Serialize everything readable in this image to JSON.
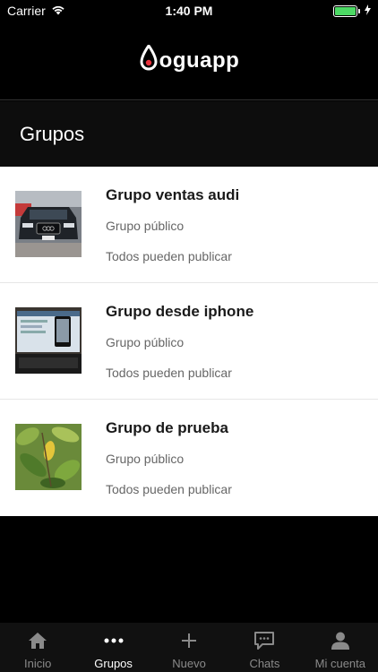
{
  "status_bar": {
    "carrier": "Carrier",
    "time": "1:40 PM",
    "battery_level": 1.0,
    "battery_color": "#4cd964"
  },
  "header": {
    "logo_text": "oguapp",
    "logo_icon": "joguapp-drop-logo"
  },
  "section": {
    "title": "Grupos"
  },
  "groups": [
    {
      "name": "Grupo ventas audi",
      "type": "Grupo público",
      "permission": "Todos pueden publicar",
      "thumbnail": "car-photo"
    },
    {
      "name": "Grupo desde iphone",
      "type": "Grupo público",
      "permission": "Todos pueden publicar",
      "thumbnail": "laptop-phone-photo"
    },
    {
      "name": "Grupo de prueba",
      "type": "Grupo público",
      "permission": "Todos pueden publicar",
      "thumbnail": "leaves-photo"
    }
  ],
  "tabs": [
    {
      "label": "Inicio",
      "icon": "home-icon",
      "active": false
    },
    {
      "label": "Grupos",
      "icon": "more-dots-icon",
      "active": true
    },
    {
      "label": "Nuevo",
      "icon": "plus-icon",
      "active": false
    },
    {
      "label": "Chats",
      "icon": "chat-bubble-icon",
      "active": false
    },
    {
      "label": "Mi cuenta",
      "icon": "user-icon",
      "active": false
    }
  ],
  "colors": {
    "background": "#000000",
    "list_background": "#ffffff",
    "active_tab": "#ffffff",
    "inactive_tab": "#8a8a8a",
    "logo_accent": "#e8323c"
  }
}
